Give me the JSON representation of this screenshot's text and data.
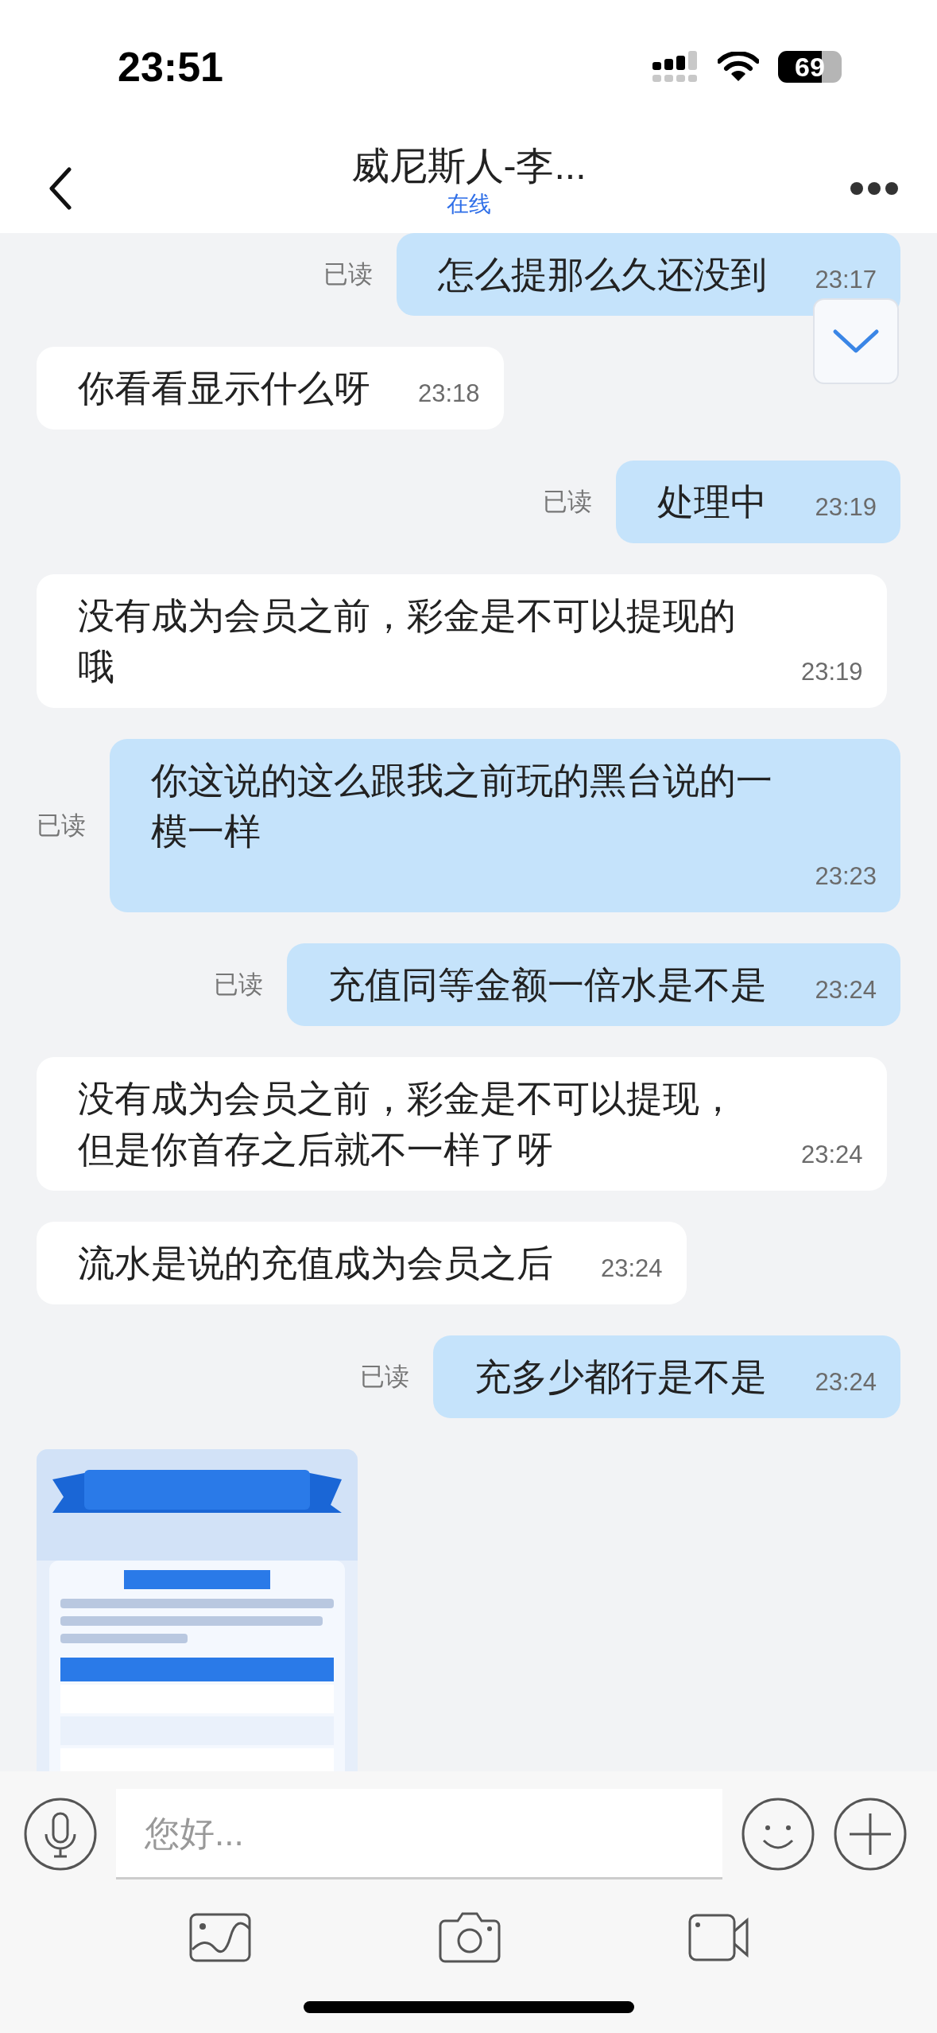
{
  "status_bar": {
    "time": "23:51",
    "battery": "69"
  },
  "header": {
    "title": "威尼斯人-李...",
    "subtitle": "在线"
  },
  "messages": [
    {
      "kind": "text",
      "outgoing": true,
      "text": "怎么提那么久还没到",
      "time": "23:17",
      "receipt": "已读"
    },
    {
      "kind": "text",
      "outgoing": false,
      "text": "你看看显示什么呀",
      "time": "23:18"
    },
    {
      "kind": "text",
      "outgoing": true,
      "text": "处理中",
      "time": "23:19",
      "receipt": "已读"
    },
    {
      "kind": "text",
      "outgoing": false,
      "text": "没有成为会员之前，彩金是不可以提现的哦",
      "time": "23:19"
    },
    {
      "kind": "text",
      "outgoing": true,
      "text": "你这说的这么跟我之前玩的黑台说的一模一样",
      "time": "23:23",
      "receipt": "已读"
    },
    {
      "kind": "text",
      "outgoing": true,
      "text": "充值同等金额一倍水是不是",
      "time": "23:24",
      "receipt": "已读"
    },
    {
      "kind": "text",
      "outgoing": false,
      "text": "没有成为会员之前，彩金是不可以提现，但是你首存之后就不一样了呀",
      "time": "23:24"
    },
    {
      "kind": "text",
      "outgoing": false,
      "text": "流水是说的充值成为会员之后",
      "time": "23:24"
    },
    {
      "kind": "text",
      "outgoing": true,
      "text": "充多少都行是不是",
      "time": "23:24",
      "receipt": "已读"
    },
    {
      "kind": "picture",
      "outgoing": false
    }
  ],
  "composer": {
    "placeholder": "您好..."
  }
}
